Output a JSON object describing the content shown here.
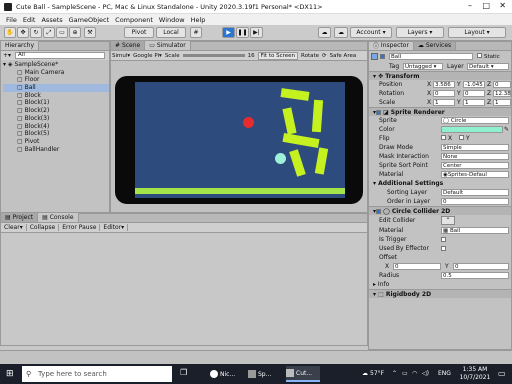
{
  "title": "Cute Ball - SampleScene - PC, Mac & Linux Standalone - Unity 2020.3.19f1 Personal* <DX11>",
  "menu": [
    "File",
    "Edit",
    "Assets",
    "GameObject",
    "Component",
    "Window",
    "Help"
  ],
  "toolbar": {
    "pivot": "Pivot",
    "local": "Local",
    "account": "Account",
    "layers": "Layers",
    "layout": "Layout"
  },
  "hierarchy": {
    "tab": "Hierarchy",
    "search_hint": "All",
    "scene": "SampleScene*",
    "items": [
      "Main Camera",
      "Floor",
      "Ball",
      "Block",
      "Block(1)",
      "Block(2)",
      "Block(3)",
      "Block(4)",
      "Block(5)",
      "Pivot",
      "BallHandler"
    ]
  },
  "viewtabs": {
    "scene": "Scene",
    "game": "Simulator"
  },
  "simulator_bar": {
    "mode": "Simul",
    "device": "Google Pi",
    "scale_label": "Scale",
    "scale_value": "16",
    "fit": "Fit to Screen",
    "rotate": "Rotate",
    "safe": "Safe Area"
  },
  "project": {
    "tab_project": "Project",
    "tab_console": "Console",
    "clear": "Clear",
    "collapse": "Collapse",
    "error_pause": "Error Pause",
    "editor": "Editor"
  },
  "inspector": {
    "tab": "Inspector",
    "tab2": "Services",
    "name": "Ball",
    "static": "Static",
    "tag_label": "Tag",
    "tag": "Untagged",
    "layer_label": "Layer",
    "layer": "Default",
    "transform": "Transform",
    "position_label": "Position",
    "pos_x": "3.586",
    "pos_y": "-1.045",
    "pos_z": "0",
    "rotation_label": "Rotation",
    "rot_x": "0",
    "rot_y": "0",
    "rot_z": "12.383",
    "scale_label": "Scale",
    "sc_x": "1",
    "sc_y": "1",
    "sc_z": "1",
    "sprite_renderer": "Sprite Renderer",
    "sprite_label": "Sprite",
    "sprite": "Circle",
    "color_label": "Color",
    "flip_label": "Flip",
    "flip_x": "X",
    "flip_y": "Y",
    "draw_mode_label": "Draw Mode",
    "draw_mode": "Simple",
    "mask_label": "Mask Interaction",
    "mask": "None",
    "sort_point_label": "Sprite Sort Point",
    "sort_point": "Center",
    "material_label": "Material",
    "material": "Sprites-Defaul",
    "additional": "Additional Settings",
    "sorting_layer_label": "Sorting Layer",
    "sorting_layer": "Default",
    "order_label": "Order in Layer",
    "order": "0",
    "collider": "Circle Collider 2D",
    "edit_collider": "Edit Collider",
    "col_material_label": "Material",
    "col_material": "Ball",
    "trigger_label": "Is Trigger",
    "effector_label": "Used By Effector",
    "offset_label": "Offset",
    "off_x": "0",
    "off_y": "0",
    "radius_label": "Radius",
    "radius": "0.5",
    "info": "Info",
    "rigidbody": "Rigidbody 2D"
  },
  "taskbar": {
    "search": "Type here to search",
    "app1": "Nic...",
    "app2": "Sp...",
    "app3": "Cut...",
    "temp": "57°F",
    "lang": "ENG",
    "time": "1:35 AM",
    "date": "10/7/2021"
  },
  "colors": {
    "game_bg": "#2e4b7e",
    "block": "#c4f11f",
    "ball_red": "#e52b2e",
    "ball_cyan": "#9ff0d8",
    "floor": "#a4e34a",
    "color_swatch": "#8ff0d0"
  }
}
